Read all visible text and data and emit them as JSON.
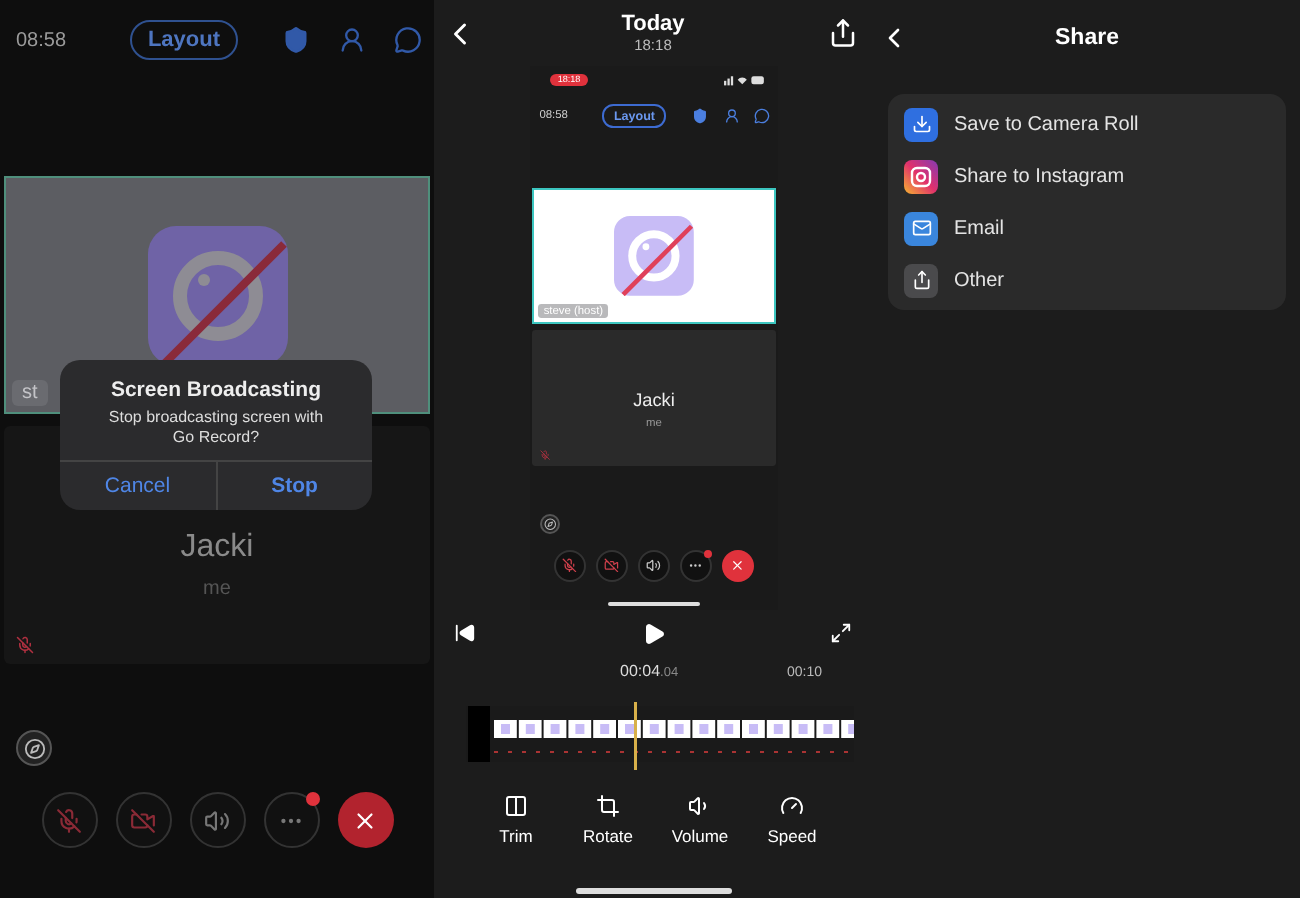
{
  "call_screen": {
    "time": "08:58",
    "layout_button": "Layout",
    "video_tile": {
      "label": "st"
    },
    "participant": {
      "name": "Jacki",
      "subtitle": "me"
    },
    "controls": [
      {
        "kind": "mic",
        "off": true,
        "badge": false
      },
      {
        "kind": "camera",
        "off": true,
        "badge": false
      },
      {
        "kind": "speaker",
        "off": false,
        "badge": false
      },
      {
        "kind": "more",
        "off": false,
        "badge": true
      },
      {
        "kind": "end",
        "off": false,
        "badge": false
      }
    ],
    "dialog": {
      "title": "Screen Broadcasting",
      "message": "Stop broadcasting screen with Go Record?",
      "buttons": [
        {
          "label": "Cancel",
          "primary": false
        },
        {
          "label": "Stop",
          "primary": true
        }
      ]
    }
  },
  "recording": {
    "title": "Today",
    "subtitle": "18:18",
    "preview": {
      "recording_badge": "18:18",
      "time": "08:58",
      "layout_button": "Layout",
      "video_tile": {
        "label": "steve (host)"
      },
      "participant": {
        "name": "Jacki",
        "subtitle": "me"
      },
      "controls": [
        {
          "kind": "mic",
          "off": true,
          "badge": false
        },
        {
          "kind": "camera",
          "off": true,
          "badge": false
        },
        {
          "kind": "speaker",
          "off": false,
          "badge": false
        },
        {
          "kind": "more",
          "off": false,
          "badge": true
        },
        {
          "kind": "end",
          "off": false,
          "badge": false
        }
      ]
    },
    "playback": {
      "current_time": "00:04",
      "current_fraction": ".04",
      "end_mark": "00:10"
    },
    "tools": [
      {
        "kind": "trim",
        "label": "Trim"
      },
      {
        "kind": "rotate",
        "label": "Rotate"
      },
      {
        "kind": "volume",
        "label": "Volume"
      },
      {
        "kind": "speed",
        "label": "Speed"
      }
    ]
  },
  "share": {
    "title": "Share",
    "options": [
      {
        "kind": "save",
        "label": "Save to Camera Roll"
      },
      {
        "kind": "instagram",
        "label": "Share to Instagram"
      },
      {
        "kind": "email",
        "label": "Email"
      },
      {
        "kind": "other",
        "label": "Other"
      }
    ]
  }
}
